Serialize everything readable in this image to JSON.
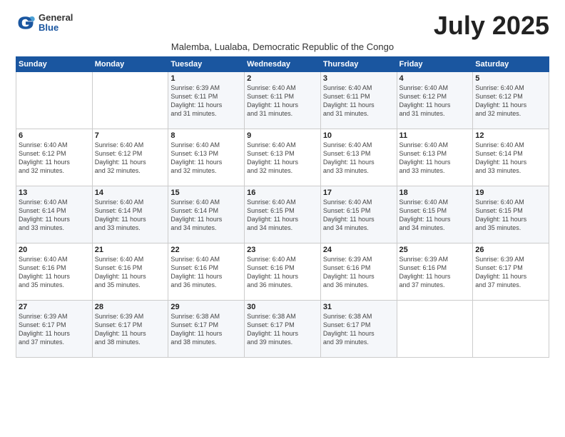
{
  "logo": {
    "general": "General",
    "blue": "Blue"
  },
  "title": "July 2025",
  "subtitle": "Malemba, Lualaba, Democratic Republic of the Congo",
  "headers": [
    "Sunday",
    "Monday",
    "Tuesday",
    "Wednesday",
    "Thursday",
    "Friday",
    "Saturday"
  ],
  "weeks": [
    [
      {
        "day": "",
        "info": ""
      },
      {
        "day": "",
        "info": ""
      },
      {
        "day": "1",
        "info": "Sunrise: 6:39 AM\nSunset: 6:11 PM\nDaylight: 11 hours\nand 31 minutes."
      },
      {
        "day": "2",
        "info": "Sunrise: 6:40 AM\nSunset: 6:11 PM\nDaylight: 11 hours\nand 31 minutes."
      },
      {
        "day": "3",
        "info": "Sunrise: 6:40 AM\nSunset: 6:11 PM\nDaylight: 11 hours\nand 31 minutes."
      },
      {
        "day": "4",
        "info": "Sunrise: 6:40 AM\nSunset: 6:12 PM\nDaylight: 11 hours\nand 31 minutes."
      },
      {
        "day": "5",
        "info": "Sunrise: 6:40 AM\nSunset: 6:12 PM\nDaylight: 11 hours\nand 32 minutes."
      }
    ],
    [
      {
        "day": "6",
        "info": "Sunrise: 6:40 AM\nSunset: 6:12 PM\nDaylight: 11 hours\nand 32 minutes."
      },
      {
        "day": "7",
        "info": "Sunrise: 6:40 AM\nSunset: 6:12 PM\nDaylight: 11 hours\nand 32 minutes."
      },
      {
        "day": "8",
        "info": "Sunrise: 6:40 AM\nSunset: 6:13 PM\nDaylight: 11 hours\nand 32 minutes."
      },
      {
        "day": "9",
        "info": "Sunrise: 6:40 AM\nSunset: 6:13 PM\nDaylight: 11 hours\nand 32 minutes."
      },
      {
        "day": "10",
        "info": "Sunrise: 6:40 AM\nSunset: 6:13 PM\nDaylight: 11 hours\nand 33 minutes."
      },
      {
        "day": "11",
        "info": "Sunrise: 6:40 AM\nSunset: 6:13 PM\nDaylight: 11 hours\nand 33 minutes."
      },
      {
        "day": "12",
        "info": "Sunrise: 6:40 AM\nSunset: 6:14 PM\nDaylight: 11 hours\nand 33 minutes."
      }
    ],
    [
      {
        "day": "13",
        "info": "Sunrise: 6:40 AM\nSunset: 6:14 PM\nDaylight: 11 hours\nand 33 minutes."
      },
      {
        "day": "14",
        "info": "Sunrise: 6:40 AM\nSunset: 6:14 PM\nDaylight: 11 hours\nand 33 minutes."
      },
      {
        "day": "15",
        "info": "Sunrise: 6:40 AM\nSunset: 6:14 PM\nDaylight: 11 hours\nand 34 minutes."
      },
      {
        "day": "16",
        "info": "Sunrise: 6:40 AM\nSunset: 6:15 PM\nDaylight: 11 hours\nand 34 minutes."
      },
      {
        "day": "17",
        "info": "Sunrise: 6:40 AM\nSunset: 6:15 PM\nDaylight: 11 hours\nand 34 minutes."
      },
      {
        "day": "18",
        "info": "Sunrise: 6:40 AM\nSunset: 6:15 PM\nDaylight: 11 hours\nand 34 minutes."
      },
      {
        "day": "19",
        "info": "Sunrise: 6:40 AM\nSunset: 6:15 PM\nDaylight: 11 hours\nand 35 minutes."
      }
    ],
    [
      {
        "day": "20",
        "info": "Sunrise: 6:40 AM\nSunset: 6:16 PM\nDaylight: 11 hours\nand 35 minutes."
      },
      {
        "day": "21",
        "info": "Sunrise: 6:40 AM\nSunset: 6:16 PM\nDaylight: 11 hours\nand 35 minutes."
      },
      {
        "day": "22",
        "info": "Sunrise: 6:40 AM\nSunset: 6:16 PM\nDaylight: 11 hours\nand 36 minutes."
      },
      {
        "day": "23",
        "info": "Sunrise: 6:40 AM\nSunset: 6:16 PM\nDaylight: 11 hours\nand 36 minutes."
      },
      {
        "day": "24",
        "info": "Sunrise: 6:39 AM\nSunset: 6:16 PM\nDaylight: 11 hours\nand 36 minutes."
      },
      {
        "day": "25",
        "info": "Sunrise: 6:39 AM\nSunset: 6:16 PM\nDaylight: 11 hours\nand 37 minutes."
      },
      {
        "day": "26",
        "info": "Sunrise: 6:39 AM\nSunset: 6:17 PM\nDaylight: 11 hours\nand 37 minutes."
      }
    ],
    [
      {
        "day": "27",
        "info": "Sunrise: 6:39 AM\nSunset: 6:17 PM\nDaylight: 11 hours\nand 37 minutes."
      },
      {
        "day": "28",
        "info": "Sunrise: 6:39 AM\nSunset: 6:17 PM\nDaylight: 11 hours\nand 38 minutes."
      },
      {
        "day": "29",
        "info": "Sunrise: 6:38 AM\nSunset: 6:17 PM\nDaylight: 11 hours\nand 38 minutes."
      },
      {
        "day": "30",
        "info": "Sunrise: 6:38 AM\nSunset: 6:17 PM\nDaylight: 11 hours\nand 39 minutes."
      },
      {
        "day": "31",
        "info": "Sunrise: 6:38 AM\nSunset: 6:17 PM\nDaylight: 11 hours\nand 39 minutes."
      },
      {
        "day": "",
        "info": ""
      },
      {
        "day": "",
        "info": ""
      }
    ]
  ]
}
